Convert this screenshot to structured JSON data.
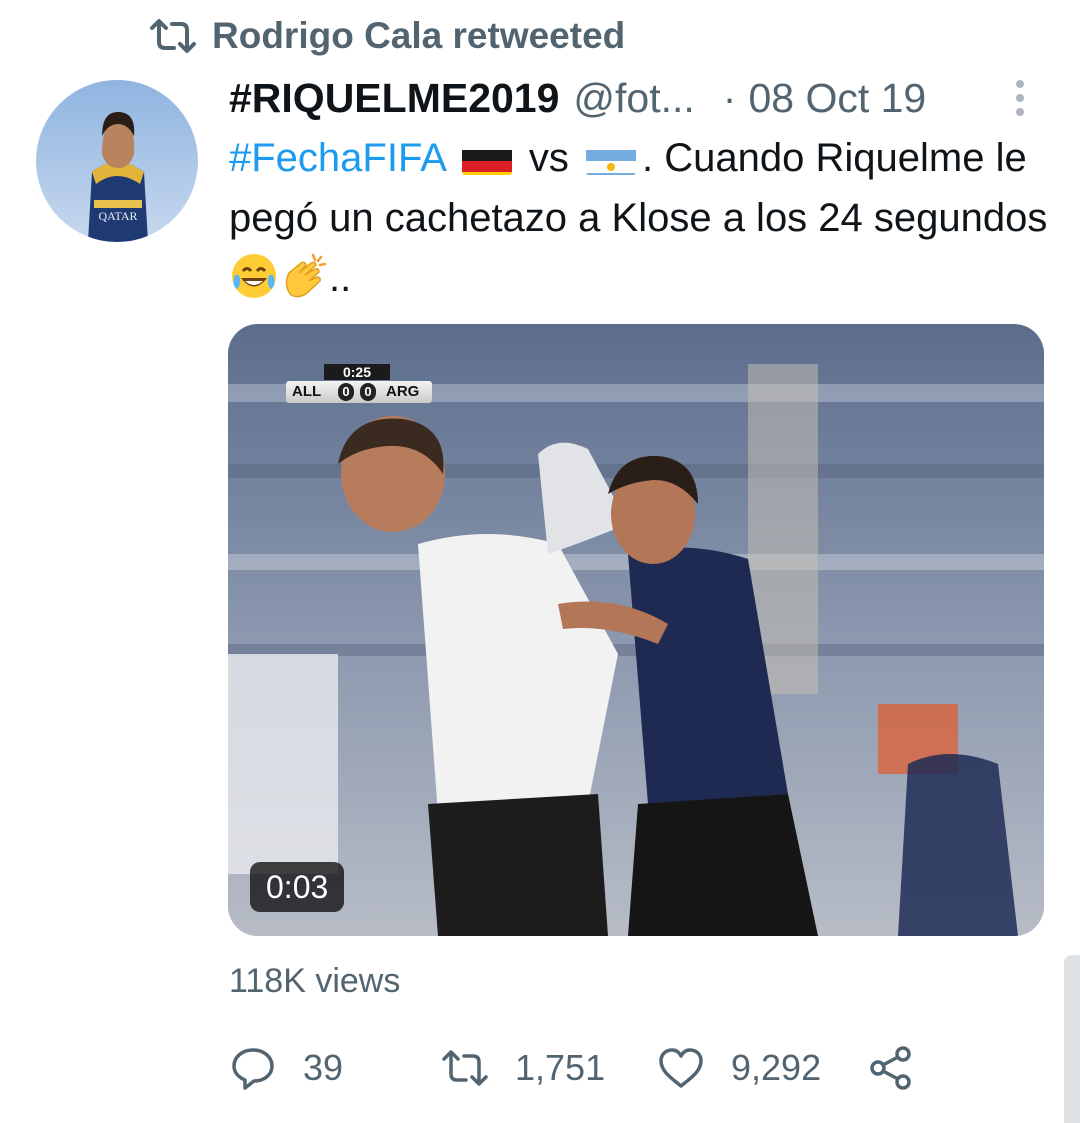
{
  "retweet": {
    "label": "Rodrigo Cala retweeted"
  },
  "tweet": {
    "display_name": "#RIQUELME2019",
    "handle": "@fot...",
    "separator": "·",
    "date": "08 Oct 19",
    "text": {
      "hashtag": "#FechaFIFA",
      "part1": "vs",
      "part2": ". Cuando Riquelme le pegó un cachetazo a Klose a los 24 segundos",
      "part3": ".."
    },
    "flags": [
      "germany-flag",
      "argentina-flag"
    ],
    "emojis": [
      "face-with-tears-of-joy",
      "clapping-hands"
    ]
  },
  "media": {
    "duration": "0:03",
    "scorebug": {
      "clock": "0:25",
      "home": "ALL",
      "home_score": "0",
      "away_score": "0",
      "away": "ARG"
    }
  },
  "views": "118K views",
  "actions": {
    "replies": "39",
    "retweets": "1,751",
    "likes": "9,292"
  },
  "colors": {
    "accent": "#1d9bf0",
    "secondary_text": "#536471",
    "primary_text": "#0f1419"
  }
}
